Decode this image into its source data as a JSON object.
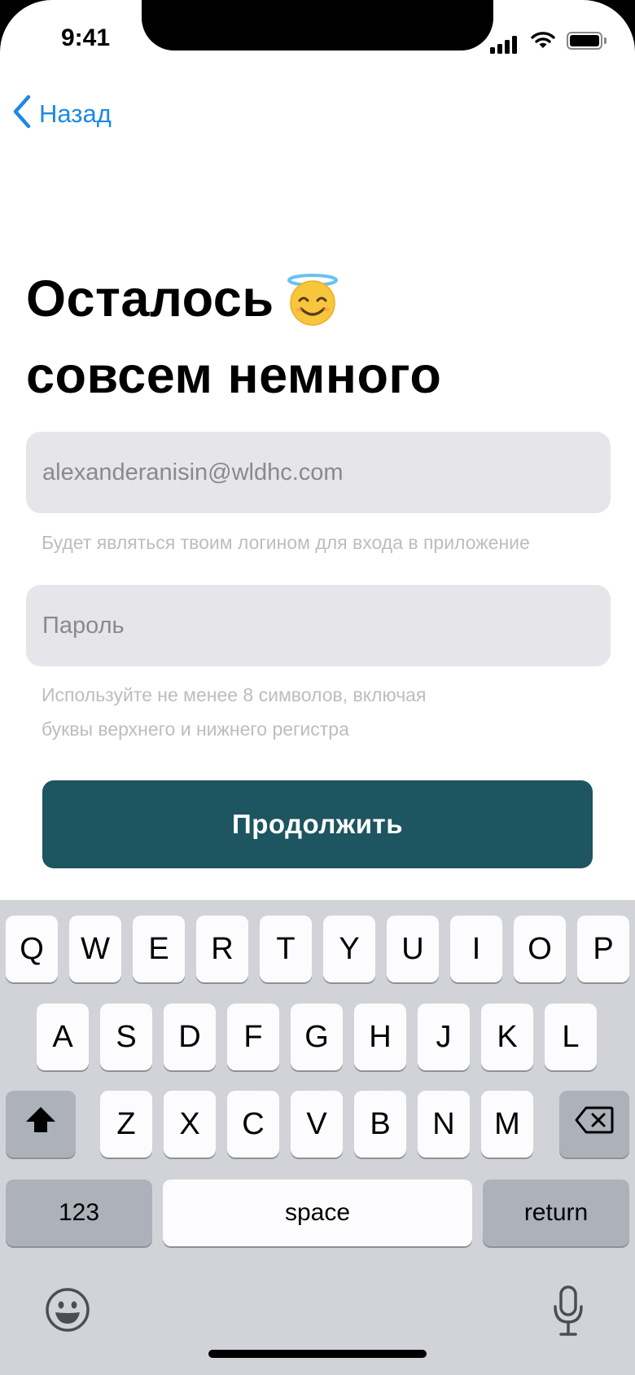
{
  "status_bar": {
    "time": "9:41",
    "signal_icon": "cellular-signal-icon",
    "wifi_icon": "wifi-icon",
    "battery_icon": "battery-icon"
  },
  "nav": {
    "back_label": "Назад",
    "back_icon": "chevron-left-icon",
    "accent_color": "#1e88e5"
  },
  "header": {
    "title_line1": "Осталось",
    "title_emoji": "smiling-face-with-halo-icon",
    "title_line2": "совсем немного"
  },
  "form": {
    "email": {
      "value": "alexanderanisin@wldhc.com",
      "hint": "Будет являться твоим логином для входа в приложение"
    },
    "password": {
      "placeholder": "Пароль",
      "hint_line1": "Используйте не менее 8 символов, включая",
      "hint_line2": "буквы верхнего и нижнего регистра"
    },
    "submit_label": "Продолжить",
    "submit_color": "#1d5560"
  },
  "keyboard": {
    "row1": [
      "Q",
      "W",
      "E",
      "R",
      "T",
      "Y",
      "U",
      "I",
      "O",
      "P"
    ],
    "row2": [
      "A",
      "S",
      "D",
      "F",
      "G",
      "H",
      "J",
      "K",
      "L"
    ],
    "row3": [
      "Z",
      "X",
      "C",
      "V",
      "B",
      "N",
      "M"
    ],
    "numbers_label": "123",
    "space_label": "space",
    "return_label": "return",
    "shift_icon": "shift-icon",
    "delete_icon": "delete-backspace-icon",
    "emoji_icon": "emoji-face-icon",
    "mic_icon": "microphone-icon"
  }
}
